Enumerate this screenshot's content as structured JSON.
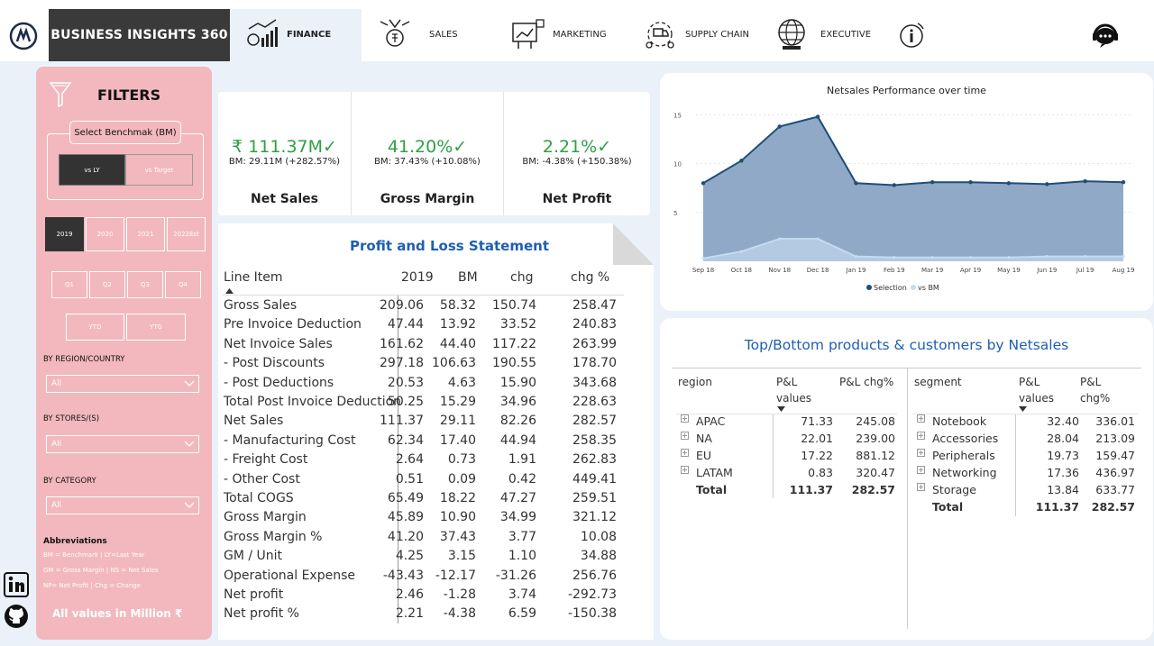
{
  "header": {
    "brand": "BUSINESS INSIGHTS 360",
    "nav": [
      {
        "label": "FINANCE",
        "icon": "finance-chart-icon",
        "active": true
      },
      {
        "label": "SALES",
        "icon": "sales-money-icon",
        "active": false
      },
      {
        "label": "MARKETING",
        "icon": "marketing-screen-icon",
        "active": false
      },
      {
        "label": "SUPPLY CHAIN",
        "icon": "supply-chain-truck-icon",
        "active": false
      },
      {
        "label": "EXECUTIVE",
        "icon": "executive-globe-icon",
        "active": false
      }
    ]
  },
  "filters": {
    "title": "FILTERS",
    "benchmark_label": "Select Benchmak (BM)",
    "benchmark_options": [
      "vs LY",
      "vs Target"
    ],
    "years": [
      "2019",
      "2020",
      "2021",
      "2022Est"
    ],
    "quarters": [
      "Q1",
      "Q2",
      "Q3",
      "Q4"
    ],
    "periods": [
      "YTD",
      "YTG"
    ],
    "region_label": "BY REGION/COUNTRY",
    "region_value": "All",
    "stores_label": "BY STORES/(S)",
    "stores_value": "All",
    "category_label": "BY CATEGORY",
    "category_value": "All",
    "abbr_title": "Abbreviations",
    "abbr_lines": [
      "BM = Benchmark | LY=Last Year",
      "GM = Gross Margin | NS = Net Sales",
      "NP= Net Profit | Chg = Change"
    ],
    "all_values": "All values in Million ₹"
  },
  "kpis": [
    {
      "value": "₹ 111.37M✓",
      "bm": "BM: 29.11M (+282.57%)",
      "name": "Net Sales"
    },
    {
      "value": "41.20%✓",
      "bm": "BM: 37.43% (+10.08%)",
      "name": "Gross Margin"
    },
    {
      "value": "2.21%✓",
      "bm": "BM: -4.38% (+150.38%)",
      "name": "Net Profit"
    }
  ],
  "pl": {
    "title": "Profit and Loss Statement",
    "headers": [
      "Line Item",
      "2019",
      "BM",
      "chg",
      "chg %"
    ],
    "rows": [
      [
        "Gross Sales",
        "209.06",
        "58.32",
        "150.74",
        "258.47"
      ],
      [
        "Pre Invoice Deduction",
        "47.44",
        "13.92",
        "33.52",
        "240.83"
      ],
      [
        "Net Invoice Sales",
        "161.62",
        "44.40",
        "117.22",
        "263.99"
      ],
      [
        "- Post Discounts",
        "297.18",
        "106.63",
        "190.55",
        "178.70"
      ],
      [
        "- Post Deductions",
        "20.53",
        "4.63",
        "15.90",
        "343.68"
      ],
      [
        "Total Post Invoice Deduction",
        "50.25",
        "15.29",
        "34.96",
        "228.63"
      ],
      [
        "Net Sales",
        "111.37",
        "29.11",
        "82.26",
        "282.57"
      ],
      [
        "- Manufacturing Cost",
        "62.34",
        "17.40",
        "44.94",
        "258.35"
      ],
      [
        "- Freight Cost",
        "2.64",
        "0.73",
        "1.91",
        "262.83"
      ],
      [
        "- Other Cost",
        "0.51",
        "0.09",
        "0.42",
        "449.41"
      ],
      [
        "Total COGS",
        "65.49",
        "18.22",
        "47.27",
        "259.51"
      ],
      [
        "Gross Margin",
        "45.89",
        "10.90",
        "34.99",
        "321.12"
      ],
      [
        "Gross Margin %",
        "41.20",
        "37.43",
        "3.77",
        "10.08"
      ],
      [
        "GM / Unit",
        "4.25",
        "3.15",
        "1.10",
        "34.88"
      ],
      [
        "Operational Expense",
        "-43.43",
        "-12.17",
        "-31.26",
        "256.76"
      ],
      [
        "Net profit",
        "2.46",
        "-1.28",
        "3.74",
        "-292.73"
      ],
      [
        "Net profit %",
        "2.21",
        "-4.38",
        "6.59",
        "-150.38"
      ]
    ]
  },
  "chart_data": {
    "type": "area",
    "title": "Netsales Performance over time",
    "categories": [
      "Sep 18",
      "Oct 18",
      "Nov 18",
      "Dec 18",
      "Jan 19",
      "Feb 19",
      "Mar 19",
      "Apr 19",
      "May 19",
      "Jun 19",
      "Jul 19",
      "Aug 19"
    ],
    "series": [
      {
        "name": "Selection",
        "color": "#1f4e79",
        "values": [
          8.0,
          10.3,
          13.8,
          14.8,
          8.0,
          7.8,
          8.1,
          8.1,
          8.0,
          7.9,
          8.2,
          8.1
        ]
      },
      {
        "name": "vs BM",
        "color": "#c6dcf0",
        "values": [
          0.3,
          1.0,
          2.3,
          2.3,
          0.5,
          0.4,
          0.4,
          0.4,
          0.4,
          0.5,
          0.5,
          0.5
        ]
      }
    ],
    "yticks": [
      5,
      10,
      15
    ],
    "ylim": [
      0,
      15.5
    ],
    "legend": "bottom"
  },
  "topbottom": {
    "title": "Top/Bottom products & customers by Netsales",
    "region_headers": [
      "region",
      "P&L values",
      "P&L chg%"
    ],
    "region_rows": [
      [
        "APAC",
        "71.33",
        "245.08"
      ],
      [
        "NA",
        "22.01",
        "239.00"
      ],
      [
        "EU",
        "17.22",
        "881.12"
      ],
      [
        "LATAM",
        "0.83",
        "320.47"
      ]
    ],
    "region_total": [
      "Total",
      "111.37",
      "282.57"
    ],
    "segment_headers": [
      "segment",
      "P&L values",
      "P&L chg%"
    ],
    "segment_rows": [
      [
        "Notebook",
        "32.40",
        "336.01"
      ],
      [
        "Accessories",
        "28.04",
        "213.09"
      ],
      [
        "Peripherals",
        "19.73",
        "159.47"
      ],
      [
        "Networking",
        "17.36",
        "436.97"
      ],
      [
        "Storage",
        "13.84",
        "633.77"
      ]
    ],
    "segment_total": [
      "Total",
      "111.37",
      "282.57"
    ]
  }
}
